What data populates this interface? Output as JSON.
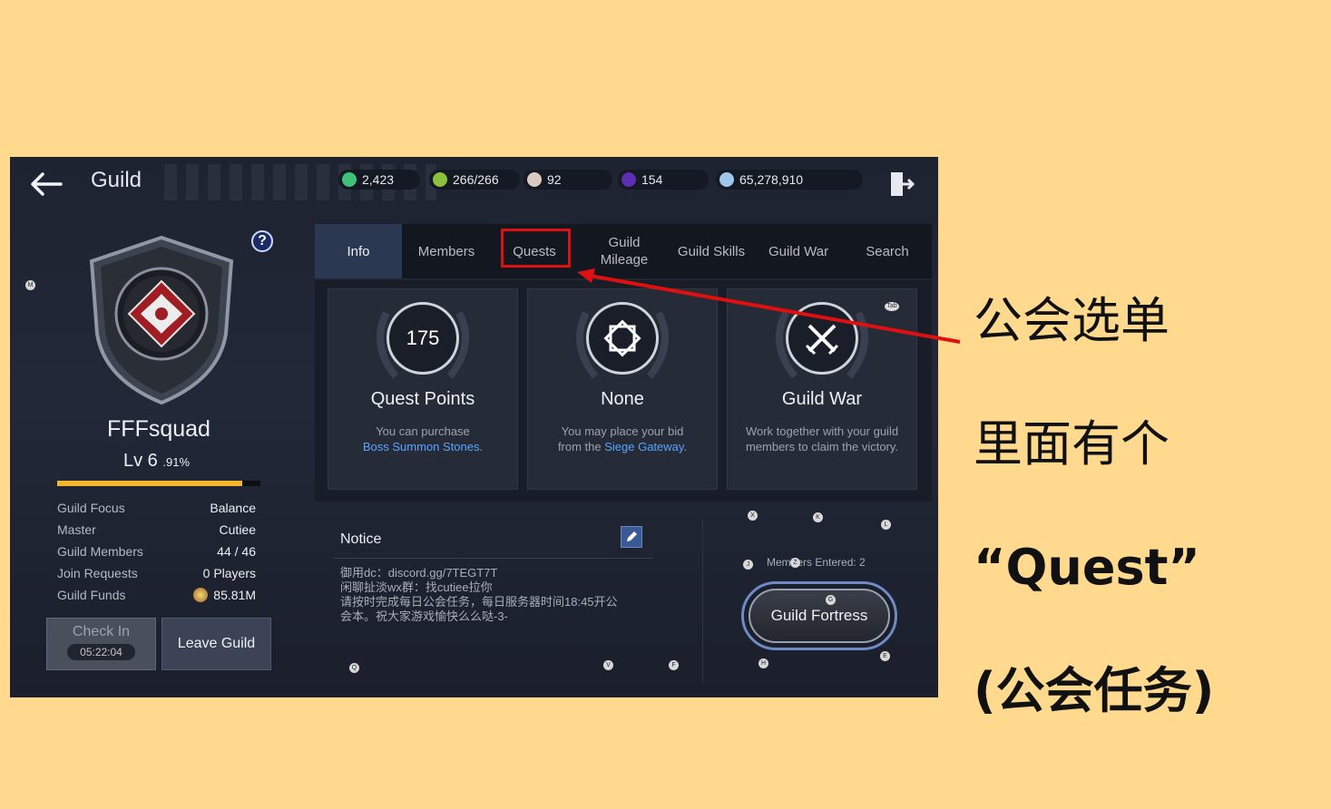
{
  "header": {
    "title": "Guild",
    "resources": [
      {
        "icon": "mileage-coin-icon",
        "value": "2,423",
        "color": "#3ec27a"
      },
      {
        "icon": "stamina-icon",
        "value": "266/266",
        "color": "#8bbf3c"
      },
      {
        "icon": "pearl-icon",
        "value": "92",
        "color": "#d9c9c0"
      },
      {
        "icon": "purple-gem-icon",
        "value": "154",
        "color": "#5b2fb2"
      },
      {
        "icon": "silver-coin-icon",
        "value": "65,278,910",
        "color": "#9fc7ee"
      }
    ]
  },
  "guild": {
    "name": "FFFsquad",
    "level": "Lv 6",
    "percent": ".91%",
    "progress": 0.91,
    "stats": [
      {
        "label": "Guild Focus",
        "value": "Balance"
      },
      {
        "label": "Master",
        "value": "Cutiee"
      },
      {
        "label": "Guild Members",
        "value": "44 / 46"
      },
      {
        "label": "Join Requests",
        "value": "0 Players"
      },
      {
        "label": "Guild Funds",
        "value": "85.81M"
      }
    ],
    "check_in_label": "Check In",
    "check_in_time": "05:22:04",
    "leave_label": "Leave Guild"
  },
  "tabs": [
    {
      "label": "Info",
      "active": true
    },
    {
      "label": "Members"
    },
    {
      "label": "Quests"
    },
    {
      "label": "Guild\nMileage"
    },
    {
      "label": "Guild Skills"
    },
    {
      "label": "Guild War"
    },
    {
      "label": "Search"
    }
  ],
  "cards": [
    {
      "medal": "175",
      "title": "Quest Points",
      "desc1": "You can purchase",
      "link": "Boss Summon Stones",
      "desc2_suffix": "."
    },
    {
      "medal": "",
      "title": "None",
      "desc1": "You may place your bid",
      "desc2_prefix": "from the ",
      "link": "Siege Gateway",
      "desc2_suffix": "."
    },
    {
      "medal": "",
      "title": "Guild War",
      "desc1": "Work together with your guild",
      "desc2": "members to claim the victory."
    }
  ],
  "notice": {
    "title": "Notice",
    "body": "御用dc：discord.gg/7TEGT7T\n闲聊扯淡wx群：找cutiee拉你\n请按时完成每日公会任务，每日服务器时间18:45开公\n会本。祝大家游戏愉快么么哒-3-"
  },
  "fortress": {
    "members_entered": "Members Entered: 2",
    "button": "Guild Fortress"
  },
  "hotkeys": [
    "M",
    "Tab",
    "X",
    "K",
    "L",
    "J",
    "Z",
    "G",
    "H",
    "E",
    "Q",
    "V",
    "F"
  ],
  "annotation": {
    "line1": "公会选单",
    "line2": "里面有个",
    "line3": "“Quest”",
    "line4": "(公会任务)",
    "color": "#e01010"
  },
  "colors": {
    "background": "#fed98e",
    "accent": "#f2b52c",
    "link": "#5aa3ff"
  }
}
